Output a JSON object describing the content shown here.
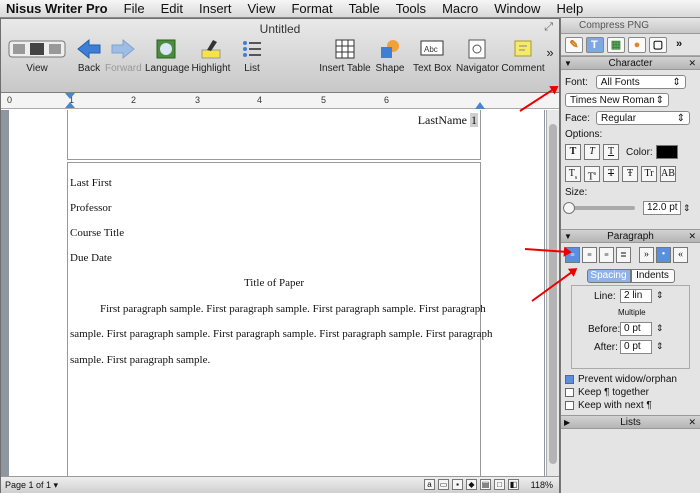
{
  "menubar": {
    "app": "Nisus Writer Pro",
    "items": [
      "File",
      "Edit",
      "Insert",
      "View",
      "Format",
      "Table",
      "Tools",
      "Macro",
      "Window",
      "Help"
    ]
  },
  "window": {
    "title": "Untitled"
  },
  "toolbar": {
    "view": "View",
    "back": "Back",
    "forward": "Forward",
    "language": "Language",
    "highlight": "Highlight",
    "list": "List",
    "insert_table": "Insert Table",
    "shape": "Shape",
    "text_box": "Text Box",
    "navigator": "Navigator",
    "comment": "Comment",
    "more": "»"
  },
  "ruler": {
    "numbers": [
      "0",
      "1",
      "2",
      "3",
      "4",
      "5",
      "6"
    ]
  },
  "document": {
    "header_text": "LastName",
    "page_number": "1",
    "lines": [
      "Last First",
      "Professor",
      "Course Title",
      "Due Date"
    ],
    "title": "Title of Paper",
    "paragraph_line1": "First paragraph sample. First paragraph sample. First paragraph sample. First paragraph",
    "paragraph_line2": "sample. First paragraph sample. First paragraph sample. First paragraph sample. First paragraph",
    "paragraph_line3": "sample. First paragraph sample."
  },
  "status": {
    "page": "Page 1 of 1 ▾",
    "zoom": "118%"
  },
  "palette": {
    "window_title": "Compress PNG",
    "character": {
      "header": "Character",
      "font_label": "Font:",
      "font_collection": "All Fonts",
      "font_name": "Times New Roman",
      "face_label": "Face:",
      "face": "Regular",
      "options_label": "Options:",
      "color_label": "Color:",
      "size_label": "Size:",
      "size_value": "12.0 pt"
    },
    "paragraph": {
      "header": "Paragraph",
      "tab_spacing": "Spacing",
      "tab_indents": "Indents",
      "line_label": "Line:",
      "line_value": "2 lin",
      "line_mode": "Multiple",
      "before_label": "Before:",
      "before_value": "0 pt",
      "after_label": "After:",
      "after_value": "0 pt",
      "prevent_widow": "Prevent widow/orphan",
      "keep_together": "Keep ¶ together",
      "keep_next": "Keep with next ¶"
    },
    "lists": {
      "header": "Lists"
    }
  },
  "colors": {
    "selected_tab": "#7da8e3",
    "annotation_arrow": "#e00000"
  }
}
